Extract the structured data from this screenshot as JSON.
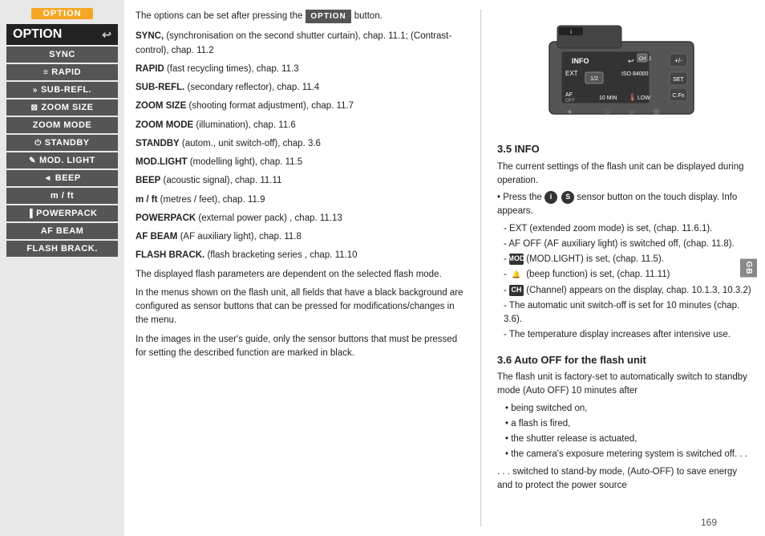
{
  "sidebar": {
    "option_badge": "OPTION",
    "title": "OPTION",
    "back_icon": "↩",
    "items": [
      {
        "label": "SYNC",
        "icon": ""
      },
      {
        "label": "RAPID",
        "icon": "≡"
      },
      {
        "label": "SUB-REFL.",
        "icon": "»"
      },
      {
        "label": "ZOOM SIZE",
        "icon": "⊠"
      },
      {
        "label": "ZOOM MODE",
        "icon": ""
      },
      {
        "label": "STANDBY",
        "icon": "⏻"
      },
      {
        "label": "MOD. LIGHT",
        "icon": "✎"
      },
      {
        "label": "BEEP",
        "icon": "◄"
      },
      {
        "label": "m / ft",
        "icon": ""
      },
      {
        "label": "POWERPACK",
        "icon": "▐"
      },
      {
        "label": "AF BEAM",
        "icon": ""
      },
      {
        "label": "FLASH BRACK.",
        "icon": ""
      }
    ]
  },
  "main": {
    "intro": "The options can be set after pressing the",
    "option_label": "OPTION",
    "button_word": "button.",
    "entries": [
      {
        "key": "SYNC,",
        "text": " (synchronisation on the second shutter curtain), chap. 11.1; (Contrast-control), chap. 11.2"
      },
      {
        "key": "RAPID",
        "text": " (fast recycling times), chap. 11.3"
      },
      {
        "key": "SUB-REFL.",
        "text": " (secondary reflector), chap. 11.4"
      },
      {
        "key": "ZOOM SIZE",
        "text": " (shooting format adjustment), chap. 11.7"
      },
      {
        "key": "ZOOM MODE",
        "text": " (illumination), chap. 11.6"
      },
      {
        "key": "STANDBY",
        "text": " (autom., unit switch-off), chap. 3.6"
      },
      {
        "key": "MOD.LIGHT",
        "text": " (modelling light), chap. 11.5"
      },
      {
        "key": "BEEP",
        "text": " (acoustic signal), chap. 11.11"
      },
      {
        "key": "m / ft",
        "text": " (metres / feet), chap. 11.9"
      },
      {
        "key": "POWERPACK",
        "text": " (external power pack) , chap. 11.13"
      },
      {
        "key": "AF BEAM",
        "text": " (AF auxiliary light), chap. 11.8"
      },
      {
        "key": "FLASH BRACK.",
        "text": " (flash bracketing series , chap. 11.10"
      }
    ],
    "para1": "The displayed flash parameters are dependent on the selected flash mode.",
    "para2": "In the menus shown on the flash unit, all fields that have a black background are configured as sensor buttons that can be pressed for modifications/changes in the menu.",
    "para3": "In the images in the user's guide, only the sensor buttons that must be pressed for setting the described function are marked in black."
  },
  "right": {
    "section1": {
      "heading": "3.5 INFO",
      "intro": "The current settings of the flash unit can be displayed during operation.",
      "press_text": "Press the",
      "press_suffix": "sensor button on the touch display. Info appears.",
      "items": [
        {
          "dash": true,
          "text": "EXT (extended zoom mode) is set, (chap. 11.6.1)."
        },
        {
          "dash": true,
          "text": "AF OFF (AF auxiliary light) is switched off, (chap. 11.8)."
        },
        {
          "dash": true,
          "icon": "MOD",
          "text": "(MOD.LIGHT) is set, (chap. 11.5)."
        },
        {
          "dash": true,
          "icon": "bell",
          "text": "(beep function) is set, (chap. 11.11)"
        },
        {
          "dash": true,
          "icon": "CH",
          "text": "(Channel) appears on the display, chap. 10.1.3, 10.3.2)"
        },
        {
          "dash": true,
          "text": "The automatic unit switch-off is set for 10 minutes (chap. 3.6)."
        },
        {
          "dash": true,
          "text": "The temperature display increases after intensive use."
        }
      ]
    },
    "section2": {
      "heading": "3.6 Auto OFF for the flash unit",
      "intro": "The flash unit is factory-set to automatically switch to standby mode (Auto OFF) 10 minutes after",
      "bullets": [
        "being switched on,",
        "a flash is fired,",
        "the shutter release is actuated,",
        "the camera's exposure metering system is switched off. . ."
      ],
      "closing": ". . . switched to stand-by mode, (Auto-OFF) to save energy and to protect the power source"
    }
  },
  "page_number": "169",
  "gb_label": "GB"
}
